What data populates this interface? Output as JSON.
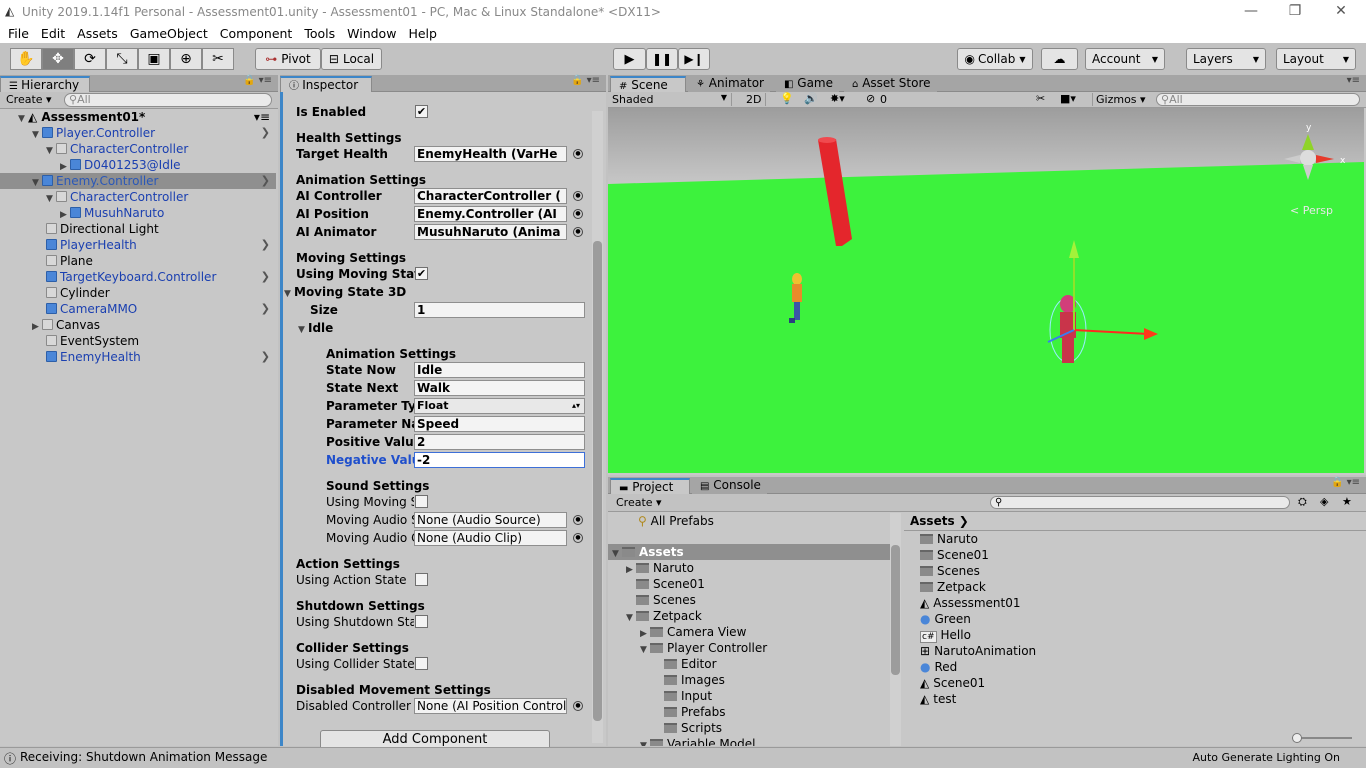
{
  "window": {
    "title": "Unity 2019.1.14f1 Personal - Assessment01.unity - Assessment01 - PC, Mac & Linux Standalone* <DX11>",
    "min": "—",
    "max": "❐",
    "close": "✕"
  },
  "menu": [
    "File",
    "Edit",
    "Assets",
    "GameObject",
    "Component",
    "Tools",
    "Window",
    "Help"
  ],
  "toolbar": {
    "pivot": "Pivot",
    "local": "Local",
    "collab": "Collab",
    "account": "Account",
    "layers": "Layers",
    "layout": "Layout"
  },
  "hierarchy": {
    "tab": "Hierarchy",
    "create": "Create",
    "search_placeholder": "All",
    "scene": "Assessment01*",
    "items": [
      {
        "label": "Player.Controller"
      },
      {
        "label": "CharacterController"
      },
      {
        "label": "D0401253@Idle"
      },
      {
        "label": "Enemy.Controller"
      },
      {
        "label": "CharacterController"
      },
      {
        "label": "MusuhNaruto"
      },
      {
        "label": "Directional Light"
      },
      {
        "label": "PlayerHealth"
      },
      {
        "label": "Plane"
      },
      {
        "label": "TargetKeyboard.Controller"
      },
      {
        "label": "Cylinder"
      },
      {
        "label": "CameraMMO"
      },
      {
        "label": "Canvas"
      },
      {
        "label": "EventSystem"
      },
      {
        "label": "EnemyHealth"
      }
    ]
  },
  "inspector": {
    "tab": "Inspector",
    "is_enabled": "Is Enabled",
    "health_settings": "Health Settings",
    "target_health": "Target Health",
    "target_health_val": "EnemyHealth (VarHe",
    "animation_settings": "Animation Settings",
    "ai_controller": "AI Controller",
    "ai_controller_val": "CharacterController (",
    "ai_position": "AI Position",
    "ai_position_val": "Enemy.Controller (AI",
    "ai_animator": "AI Animator",
    "ai_animator_val": "MusuhNaruto (Anima",
    "moving_settings": "Moving Settings",
    "using_moving_state": "Using Moving State",
    "moving_state_3d": "Moving State 3D",
    "size": "Size",
    "size_val": "1",
    "idle": "Idle",
    "anim_settings2": "Animation Settings",
    "state_now": "State Now",
    "state_now_val": "Idle",
    "state_next": "State Next",
    "state_next_val": "Walk",
    "param_type": "Parameter Ty",
    "param_type_val": "Float",
    "param_name": "Parameter Na",
    "param_name_val": "Speed",
    "positive_value": "Positive Value",
    "positive_value_val": "2",
    "negative_value": "Negative Valu",
    "negative_value_val": "-2",
    "sound_settings": "Sound Settings",
    "using_moving_s": "Using Moving S",
    "moving_audio_s": "Moving Audio S",
    "moving_audio_s_val": "None (Audio Source)",
    "moving_audio_c": "Moving Audio C",
    "moving_audio_c_val": "None (Audio Clip)",
    "action_settings": "Action Settings",
    "using_action_state": "Using Action State",
    "shutdown_settings": "Shutdown Settings",
    "using_shutdown_state": "Using Shutdown Stat",
    "collider_settings": "Collider Settings",
    "using_collider_state": "Using Collider State",
    "disabled_movement": "Disabled Movement Settings",
    "disabled_controller": "Disabled Controller",
    "disabled_controller_val": "None (AI Position Controll",
    "add_component": "Add Component"
  },
  "scene_view": {
    "tabs": [
      "Scene",
      "Animator",
      "Game",
      "Asset Store"
    ],
    "shading": "Shaded",
    "mode2d": "2D",
    "gizmos": "Gizmos",
    "search_placeholder": "All",
    "hidden_count": "0",
    "persp": "< Persp",
    "ground_color": "#3df23d",
    "sky_color": "#c9c9c9"
  },
  "project": {
    "tabs": [
      "Project",
      "Console"
    ],
    "create": "Create",
    "all_prefabs": "All Prefabs",
    "tree": [
      {
        "label": "Assets"
      },
      {
        "label": "Naruto"
      },
      {
        "label": "Scene01"
      },
      {
        "label": "Scenes"
      },
      {
        "label": "Zetpack"
      },
      {
        "label": "Camera View"
      },
      {
        "label": "Player Controller"
      },
      {
        "label": "Editor"
      },
      {
        "label": "Images"
      },
      {
        "label": "Input"
      },
      {
        "label": "Prefabs"
      },
      {
        "label": "Scripts"
      },
      {
        "label": "Variable Model"
      }
    ],
    "breadcrumb": "Assets",
    "assets": [
      {
        "label": "Naruto",
        "icon": "folder-icon"
      },
      {
        "label": "Scene01",
        "icon": "folder-icon"
      },
      {
        "label": "Scenes",
        "icon": "folder-icon"
      },
      {
        "label": "Zetpack",
        "icon": "folder-icon"
      },
      {
        "label": "Assessment01",
        "icon": "unity-scene-icon"
      },
      {
        "label": "Green",
        "icon": "material-icon"
      },
      {
        "label": "Hello",
        "icon": "script-icon"
      },
      {
        "label": "NarutoAnimation",
        "icon": "animator-icon"
      },
      {
        "label": "Red",
        "icon": "material-icon"
      },
      {
        "label": "Scene01",
        "icon": "unity-scene-icon"
      },
      {
        "label": "test",
        "icon": "unity-scene-icon"
      }
    ]
  },
  "status": {
    "message": "Receiving: Shutdown Animation Message",
    "lighting": "Auto Generate Lighting On"
  }
}
